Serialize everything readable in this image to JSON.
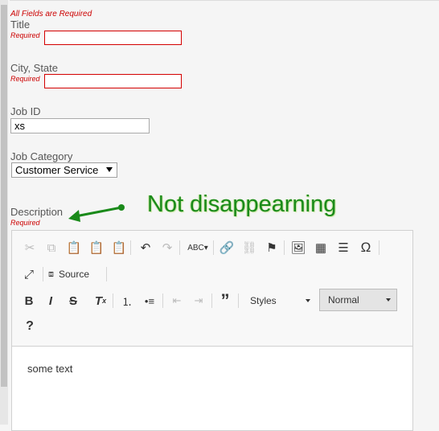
{
  "form": {
    "required_note": "All Fields are Required",
    "title_label": "Title",
    "required_text": "Required",
    "city_label": "City, State",
    "jobid_label": "Job ID",
    "jobid_value": "xs",
    "category_label": "Job Category",
    "category_value": "Customer Service",
    "description_label": "Description"
  },
  "annotation": {
    "text": "Not disappearning",
    "color": "#1a8a1a"
  },
  "editor": {
    "source_label": "Source",
    "styles_label": "Styles",
    "format_label": "Normal",
    "content": "some text",
    "special_char": "Ω",
    "help_char": "?"
  },
  "colors": {
    "required_red": "#cc0000",
    "error_border": "#d40000"
  }
}
